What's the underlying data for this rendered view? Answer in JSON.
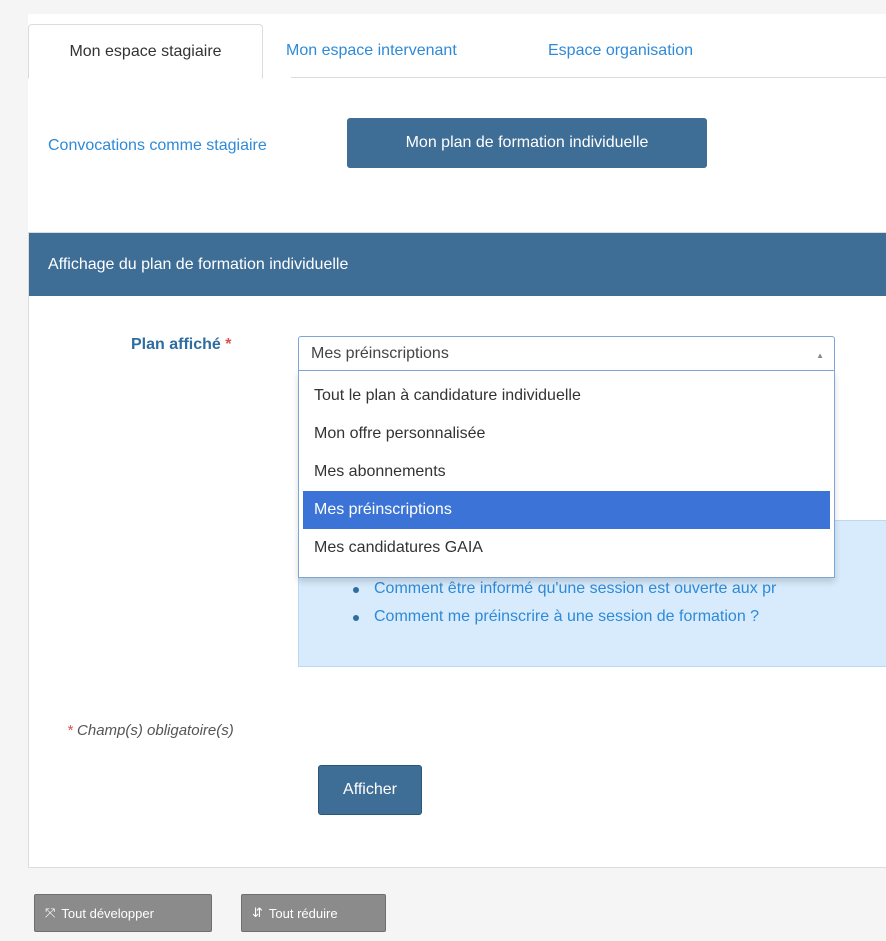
{
  "tabs": {
    "active": "Mon espace stagiaire",
    "others": [
      "Mon espace intervenant",
      "Espace organisation"
    ]
  },
  "pills": {
    "link": "Convocations comme stagiaire",
    "active": "Mon plan de formation individuelle"
  },
  "panel": {
    "title": "Affichage du plan de formation individuelle",
    "field_label": "Plan affiché",
    "required_star": "*",
    "select_value": "Mes préinscriptions",
    "options": [
      "Tout le plan à candidature individuelle",
      "Mon offre personnalisée",
      "Mes abonnements",
      "Mes préinscriptions",
      "Mes candidatures GAIA"
    ],
    "help_links": [
      "Comment être informé qu'une session est ouverte aux pr",
      "Comment me préinscrire à une session de formation ?"
    ],
    "required_note": "* Champ(s) obligatoire(s)",
    "submit_label": "Afficher"
  },
  "footer_buttons": {
    "expand": "Tout développer",
    "collapse": "Tout réduire"
  },
  "colors": {
    "primary": "#3e6d96",
    "link": "#2e8ad8",
    "highlight": "#3b74d6",
    "help_bg": "#d7ebfc"
  }
}
